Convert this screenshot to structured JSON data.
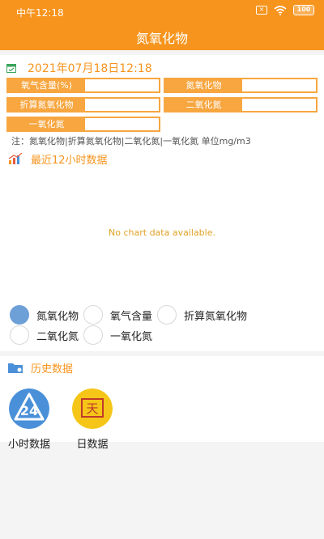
{
  "status_bar": {
    "time": "中午12:18",
    "sim_badge": "×",
    "battery": "100"
  },
  "header": {
    "title": "氮氧化物"
  },
  "summary": {
    "datetime": "2021年07月18日12:18",
    "fields": [
      {
        "label": "氧气含量(%)",
        "value": ""
      },
      {
        "label": "氮氧化物",
        "value": ""
      },
      {
        "label": "折算氮氧化物",
        "value": ""
      },
      {
        "label": "二氧化氮",
        "value": ""
      },
      {
        "label": "一氧化氮",
        "value": ""
      }
    ],
    "note": "注：氮氧化物|折算氮氧化物|二氧化氮|一氧化氮 单位mg/m3"
  },
  "chart_section": {
    "title": "最近12小时数据",
    "empty_message": "No chart data available.",
    "options": [
      {
        "label": "氮氧化物",
        "selected": true
      },
      {
        "label": "氧气含量",
        "selected": false
      },
      {
        "label": "折算氮氧化物",
        "selected": false
      },
      {
        "label": "二氧化氮",
        "selected": false
      },
      {
        "label": "一氧化氮",
        "selected": false
      }
    ]
  },
  "history": {
    "title": "历史数据",
    "items": [
      {
        "label": "小时数据",
        "icon_text": "24",
        "icon": "recycle-24-icon",
        "color": "#4a90d9"
      },
      {
        "label": "日数据",
        "icon_text": "天",
        "icon": "calendar-day-icon",
        "color": "#f5c518"
      }
    ]
  },
  "colors": {
    "accent": "#f7941d",
    "field_border": "#f7a640",
    "radio_selected": "#6ea0d8"
  }
}
